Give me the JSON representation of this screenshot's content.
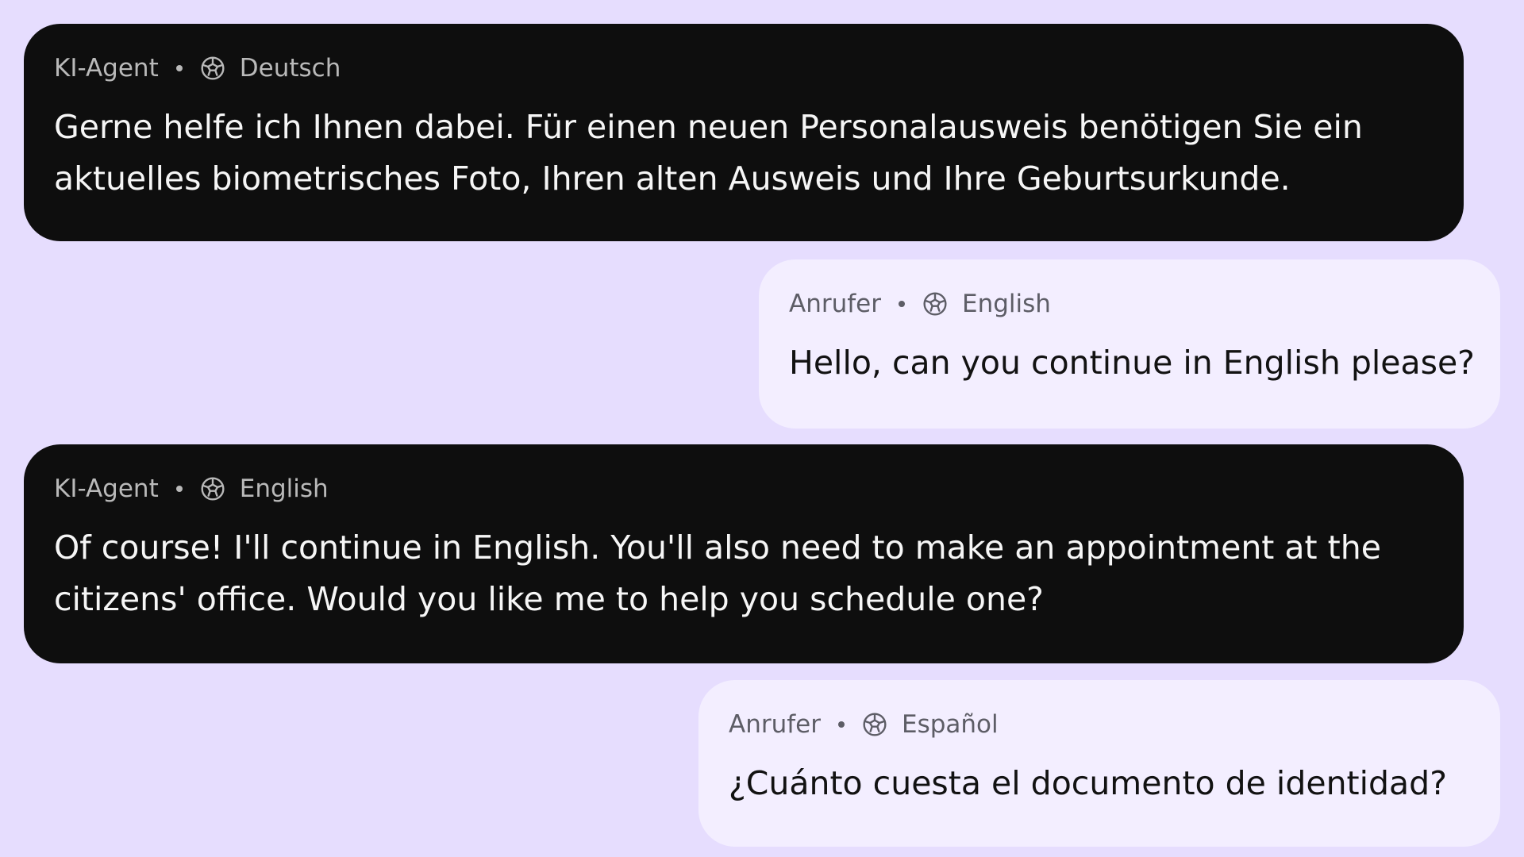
{
  "messages": [
    {
      "role": "agent",
      "speaker": "KI-Agent",
      "language": "Deutsch",
      "text": "Gerne helfe ich Ihnen dabei. Für einen neuen Personalausweis benötigen Sie ein aktuelles biometrisches Foto, Ihren alten Ausweis und Ihre Geburtsurkunde."
    },
    {
      "role": "caller",
      "speaker": "Anrufer",
      "language": "English",
      "text": "Hello, can you continue in English please?"
    },
    {
      "role": "agent",
      "speaker": "KI-Agent",
      "language": "English",
      "text": "Of course! I'll continue in English. You'll also need to make an appointment at the citizens' office. Would you like me to help you schedule one?"
    },
    {
      "role": "caller",
      "speaker": "Anrufer",
      "language": "Español",
      "text": "¿Cuánto cuesta el documento de identidad?"
    }
  ],
  "icons": {
    "language": "globe-icon"
  },
  "colors": {
    "background": "#e6ddfe",
    "agent_bubble": "#0e0e0e",
    "caller_bubble": "#f3eeff"
  }
}
